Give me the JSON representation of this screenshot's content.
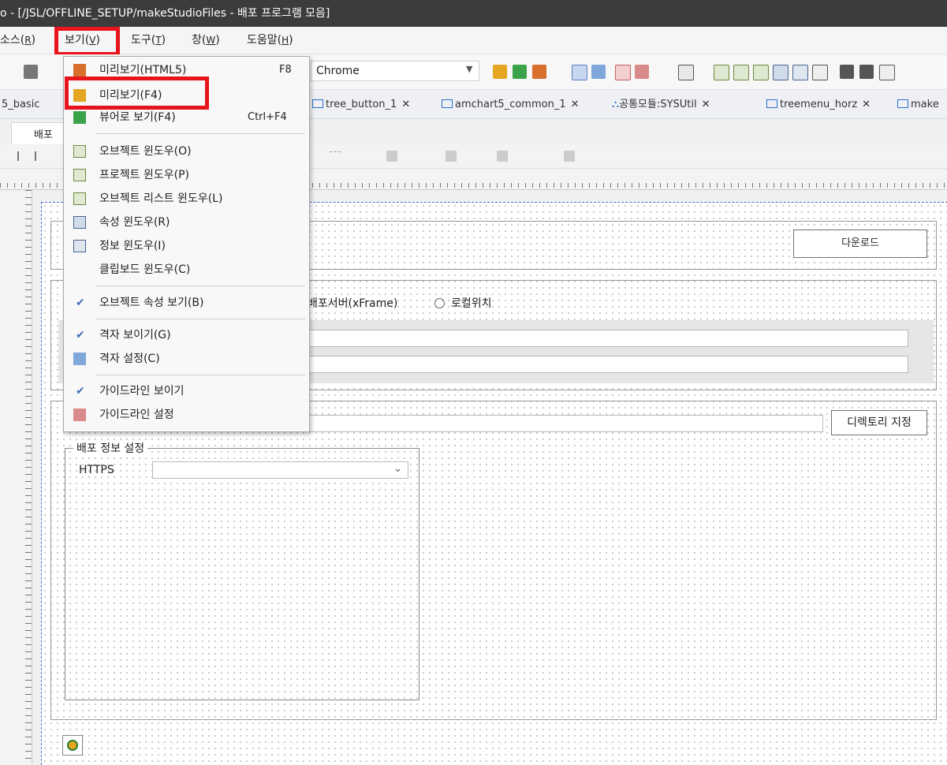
{
  "title_bar": {
    "title": "o - [/JSL/OFFLINE_SETUP/makeStudioFiles - 배포 프로그램 모음]"
  },
  "menubar": [
    {
      "label": "소스(",
      "key": "R",
      "tail": ")"
    },
    {
      "label": "보기(",
      "key": "V",
      "tail": ")"
    },
    {
      "label": "도구(",
      "key": "T",
      "tail": ")"
    },
    {
      "label": "창(",
      "key": "W",
      "tail": ")"
    },
    {
      "label": "도움말(",
      "key": "H",
      "tail": ")"
    }
  ],
  "toolbar": {
    "browser_combo": "Chrome"
  },
  "tabs": [
    "5_basic",
    "tree_button_1",
    "amchart5_common_1",
    "공통모듈:SYSUtil",
    "treemenu_horz",
    "make"
  ],
  "subtab": {
    "label": "배포"
  },
  "view_menu": {
    "items": [
      {
        "label": "미리보기(HTML5)",
        "shortcut": "F8",
        "icon": "html5-preview-icon"
      },
      {
        "label": "미리보기(F4)",
        "shortcut": "",
        "icon": "preview-icon",
        "highlighted": true
      },
      {
        "label": "뷰어로 보기(F4)",
        "shortcut": "Ctrl+F4",
        "icon": "viewer-play-icon"
      },
      {
        "label": "오브젝트 윈도우(O)",
        "shortcut": "",
        "icon": "object-window-icon"
      },
      {
        "label": "프로젝트 윈도우(P)",
        "shortcut": "",
        "icon": "project-window-icon"
      },
      {
        "label": "오브젝트 리스트 윈도우(L)",
        "shortcut": "",
        "icon": "object-list-window-icon"
      },
      {
        "label": "속성 윈도우(R)",
        "shortcut": "",
        "icon": "property-window-icon"
      },
      {
        "label": "정보 윈도우(I)",
        "shortcut": "",
        "icon": "info-window-icon"
      },
      {
        "label": "클립보드 윈도우(C)",
        "shortcut": "",
        "icon": ""
      },
      {
        "label": "오브젝트 속성 보기(B)",
        "shortcut": "",
        "icon": "check-icon",
        "checked": true
      },
      {
        "label": "격자 보이기(G)",
        "shortcut": "",
        "icon": "check-icon",
        "checked": true
      },
      {
        "label": "격자 설정(C)",
        "shortcut": "",
        "icon": "grid-setting-icon"
      },
      {
        "label": "가이드라인 보이기",
        "shortcut": "",
        "icon": "check-icon",
        "checked": true
      },
      {
        "label": "가이드라인 설정",
        "shortcut": "",
        "icon": "guideline-setting-icon"
      }
    ]
  },
  "form": {
    "download_button": "다운로드",
    "radio_server_label": "배포서버(xFrame)",
    "radio_local_label": "로컬위치",
    "directory_button": "디렉토리 지정",
    "deploy_group_title": "배포 정보 설정",
    "https_label": "HTTPS"
  },
  "colors": {
    "highlight": "#e8141b",
    "title_bg": "#3c3c3c",
    "guide_blue": "#4a6fd6"
  }
}
